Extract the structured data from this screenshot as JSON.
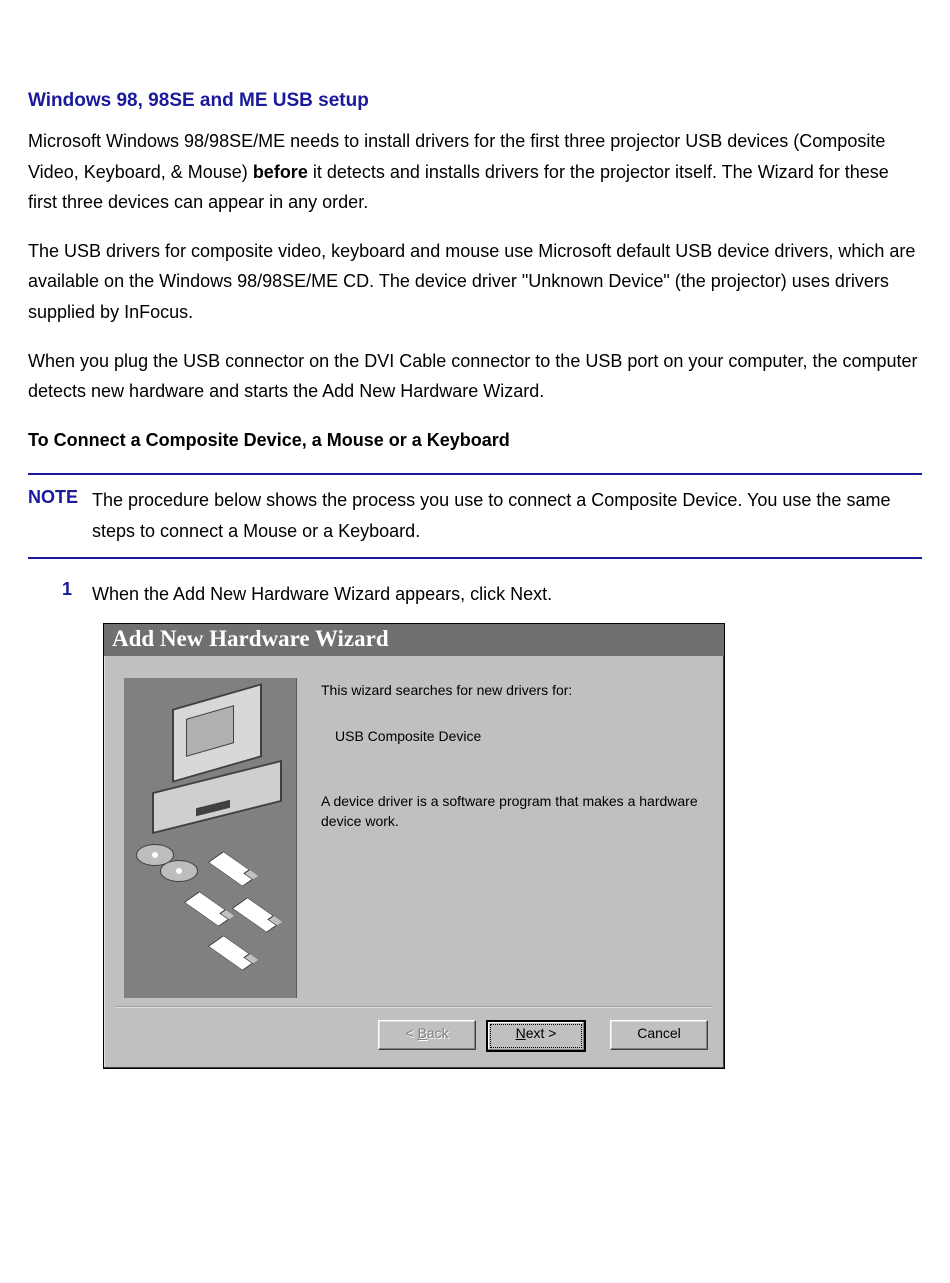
{
  "title": "Windows 98, 98SE and ME USB setup",
  "para1_a": "Microsoft Windows 98/98SE/ME needs to install drivers for the first three projector USB devices (Composite Video, Keyboard, & Mouse) ",
  "para1_bold": "before",
  "para1_b": " it detects and installs drivers for the projector itself. The Wizard for these first three devices can appear in any order.",
  "para2": "The USB drivers for composite video, keyboard and mouse use Microsoft default USB device drivers, which are available on the Windows 98/98SE/ME CD. The device driver \"Unknown Device\" (the projector) uses drivers supplied by InFocus.",
  "para3": "When you plug the USB connector on the DVI Cable connector to the USB port on your computer, the computer detects new hardware and starts the Add New Hardware Wizard.",
  "subhead": "To Connect a Composite Device, a Mouse or a Keyboard",
  "note_label": "NOTE",
  "note_text": "The procedure below shows the process you use to connect a Composite Device. You use the same steps to connect a Mouse or a Keyboard.",
  "step_num": "1",
  "step_text": "When the Add New Hardware Wizard appears, click Next.",
  "wizard": {
    "title": "Add New Hardware Wizard",
    "intro": "This wizard searches for new drivers for:",
    "device": "USB Composite Device",
    "desc": "A device driver is a software program that makes a hardware device work.",
    "buttons": {
      "back": "< Back",
      "next": "Next >",
      "cancel": "Cancel"
    }
  }
}
